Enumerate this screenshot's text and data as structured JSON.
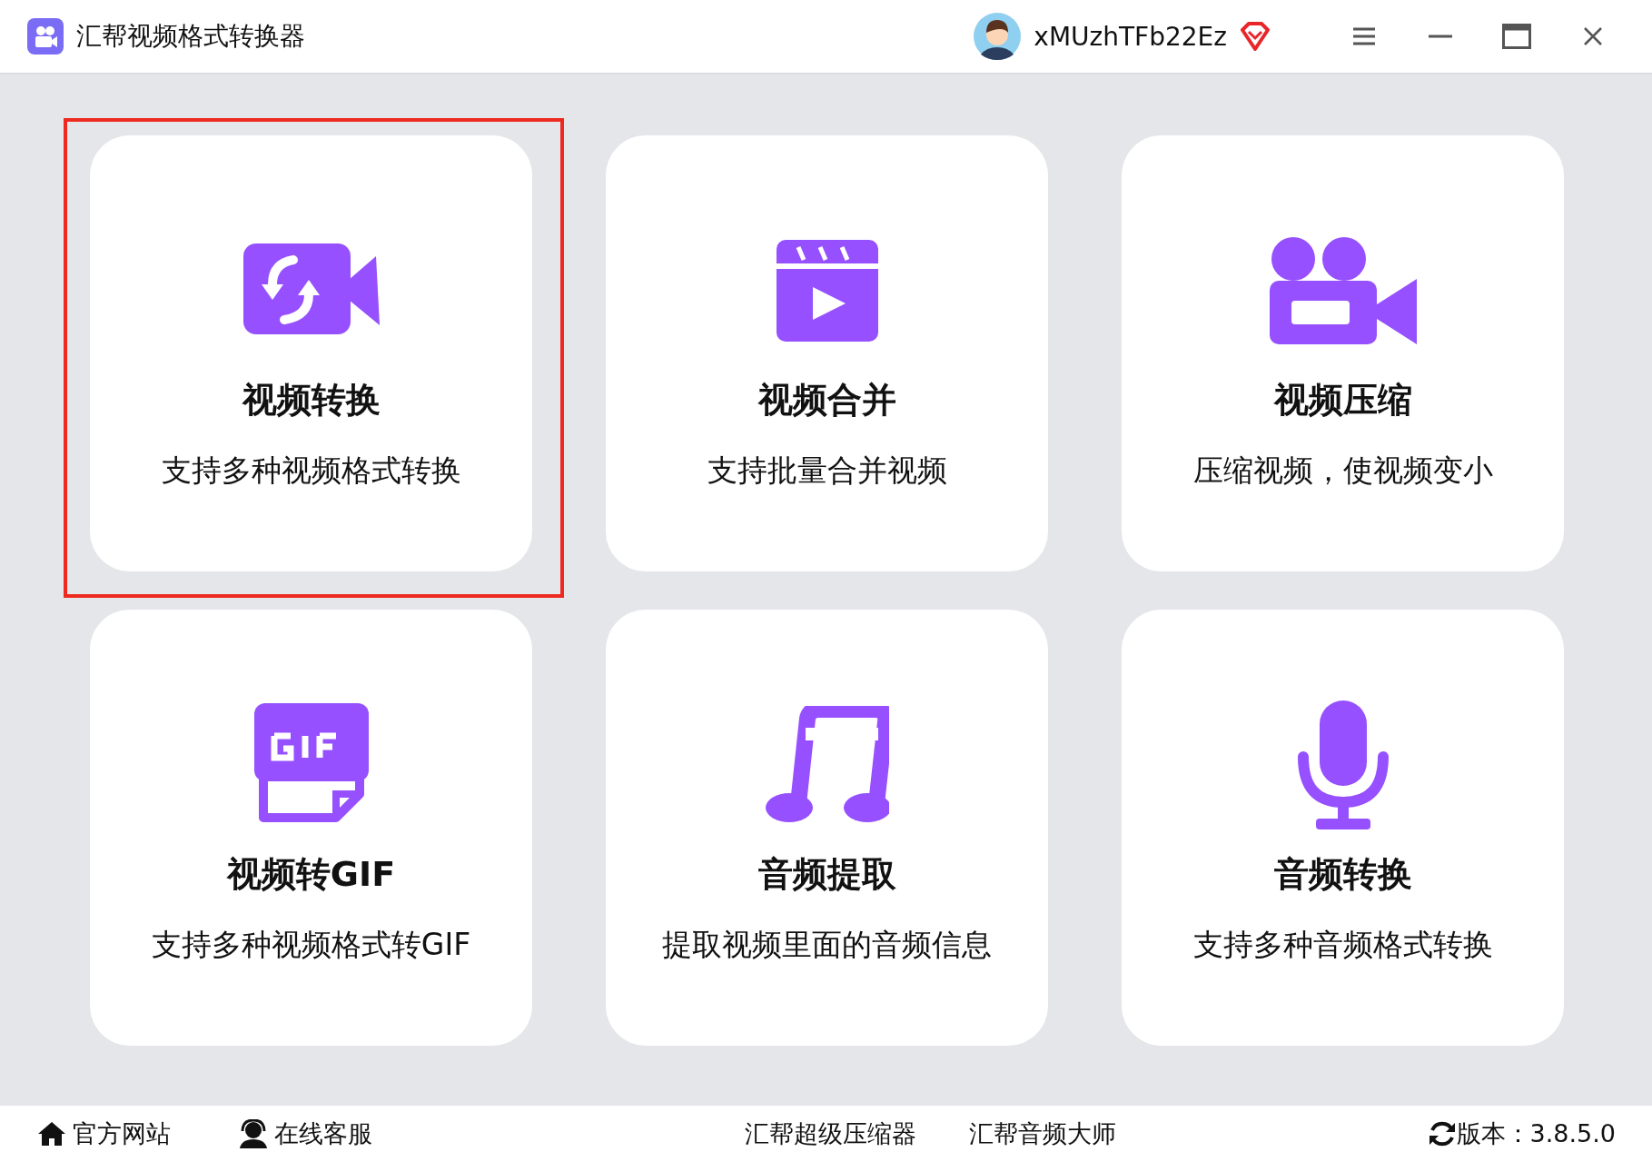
{
  "window": {
    "title": "汇帮视频格式转换器",
    "username": "xMUzhTFb22Ez"
  },
  "tools": [
    {
      "kind": "convert",
      "title": "视频转换",
      "description": "支持多种视频格式转换",
      "selected": true
    },
    {
      "kind": "merge",
      "title": "视频合并",
      "description": "支持批量合并视频",
      "selected": false
    },
    {
      "kind": "compress",
      "title": "视频压缩",
      "description": "压缩视频，使视频变小",
      "selected": false
    },
    {
      "kind": "gif",
      "title": "视频转GIF",
      "description": "支持多种视频格式转GIF",
      "selected": false
    },
    {
      "kind": "extract",
      "title": "音频提取",
      "description": "提取视频里面的音频信息",
      "selected": false
    },
    {
      "kind": "audio",
      "title": "音频转换",
      "description": "支持多种音频格式转换",
      "selected": false
    }
  ],
  "status_bar": {
    "left": [
      {
        "kind": "home",
        "label": "官方网站"
      },
      {
        "kind": "support",
        "label": "在线客服"
      }
    ],
    "center": [
      "汇帮超级压缩器",
      "汇帮音频大师"
    ],
    "version": "版本：3.8.5.0"
  }
}
